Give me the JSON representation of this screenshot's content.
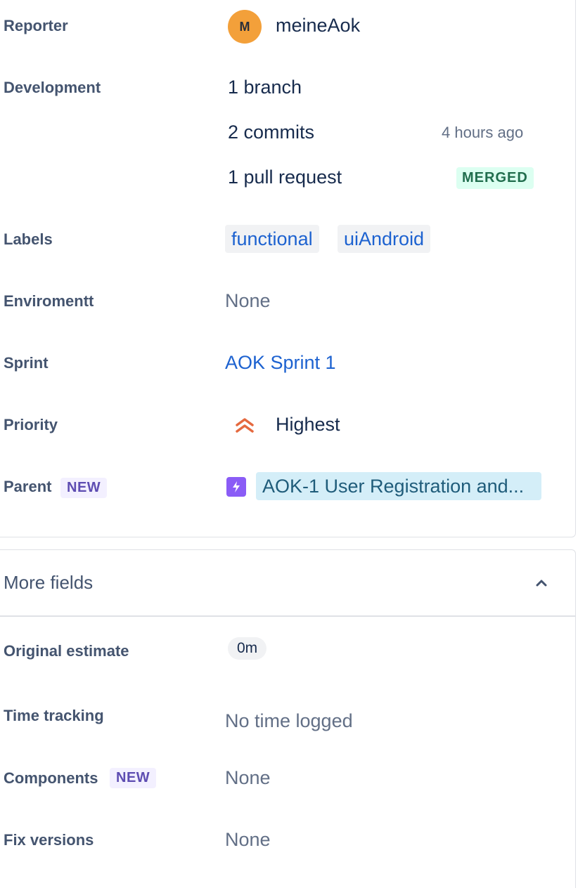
{
  "fields": {
    "reporter": {
      "label": "Reporter",
      "avatar_initial": "M",
      "value": "meineAok"
    },
    "development": {
      "label": "Development",
      "branch": "1 branch",
      "commits": "2 commits",
      "commits_time": "4 hours ago",
      "pull_request": "1 pull request",
      "pr_status": "MERGED"
    },
    "labels": {
      "label": "Labels",
      "items": [
        "functional",
        "uiAndroid"
      ]
    },
    "environment": {
      "label": "Enviromentt",
      "value": "None"
    },
    "sprint": {
      "label": "Sprint",
      "value": "AOK Sprint 1"
    },
    "priority": {
      "label": "Priority",
      "value": "Highest",
      "icon": "highest-priority-icon",
      "color": "#e5693f"
    },
    "parent": {
      "label": "Parent",
      "badge": "NEW",
      "value": "AOK-1 User Registration and...",
      "icon": "epic-lightning-icon",
      "color": "#8a5cf6"
    }
  },
  "more_fields": {
    "title": "More fields",
    "original_estimate": {
      "label": "Original estimate",
      "value": "0m"
    },
    "time_tracking": {
      "label": "Time tracking",
      "value": "No time logged"
    },
    "components": {
      "label": "Components",
      "badge": "NEW",
      "value": "None"
    },
    "fix_versions": {
      "label": "Fix versions",
      "value": "None"
    }
  }
}
